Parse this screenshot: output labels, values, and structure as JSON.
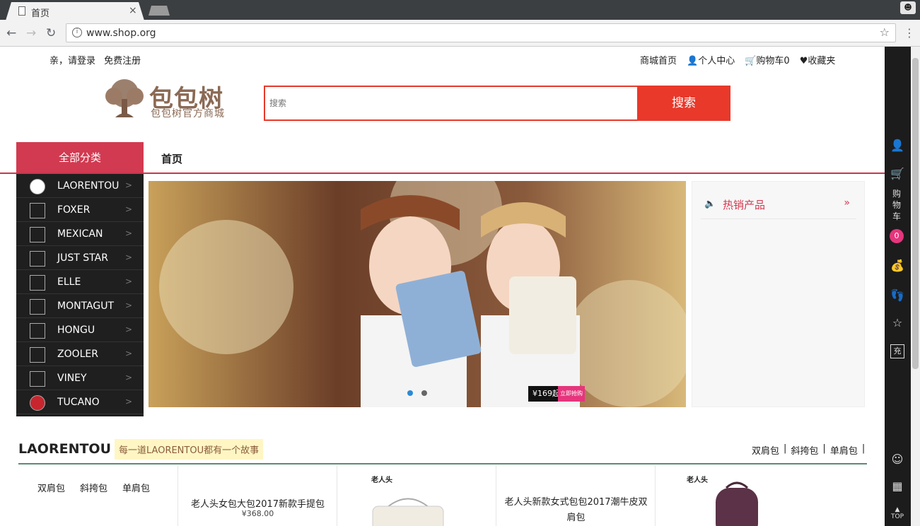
{
  "browser": {
    "tab_title": "首页",
    "tab_close": "×",
    "url": "www.shop.org"
  },
  "topbar": {
    "login": "亲，请登录",
    "register": "免费注册",
    "home": "商城首页",
    "user_center": "个人中心",
    "cart": "购物车0",
    "favorites": "收藏夹"
  },
  "logo": {
    "name": "包包树",
    "slogan": "包包树官方商城"
  },
  "search": {
    "placeholder": "搜索",
    "button": "搜索"
  },
  "nav": {
    "all_categories": "全部分类",
    "home": "首页"
  },
  "categories": [
    {
      "name": "LAORENTOU",
      "arrow": ">"
    },
    {
      "name": "FOXER",
      "arrow": ">"
    },
    {
      "name": "MEXICAN",
      "arrow": ">"
    },
    {
      "name": "JUST STAR",
      "arrow": ">"
    },
    {
      "name": "ELLE",
      "arrow": ">"
    },
    {
      "name": "MONTAGUT",
      "arrow": ">"
    },
    {
      "name": "HONGU",
      "arrow": ">"
    },
    {
      "name": "ZOOLER",
      "arrow": ">"
    },
    {
      "name": "VINEY",
      "arrow": ">"
    },
    {
      "name": "TUCANO",
      "arrow": ">"
    }
  ],
  "banner": {
    "price": "¥169起",
    "buy": "立即抢购"
  },
  "hot": {
    "title": "热销产品",
    "more": "»"
  },
  "floor": {
    "brand": "LAORENTOU",
    "slogan": "每一道LAORENTOU都有一个故事",
    "tabs": [
      "双肩包",
      "斜挎包",
      "单肩包"
    ],
    "sub_tabs": [
      "双肩包",
      "斜挎包",
      "单肩包"
    ],
    "products": [
      {
        "title": "老人头女包大包2017新款手提包",
        "price": "¥368.00"
      },
      {
        "title": "老人头新款女式包包2017潮牛皮双肩包",
        "price": ""
      }
    ],
    "brand_label": "老人头"
  },
  "right_bar": {
    "cart_label": "购物车",
    "cart_count": "0",
    "top_label": "TOP",
    "recharge": "充"
  }
}
